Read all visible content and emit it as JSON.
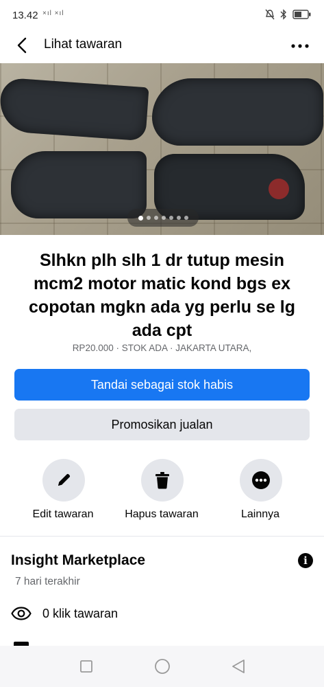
{
  "status_bar": {
    "time": "13.42",
    "signal_indicator": "×ıl ×ıl",
    "icons": [
      "mute-icon",
      "bluetooth-icon",
      "battery-icon"
    ]
  },
  "header": {
    "title": "Lihat tawaran",
    "back_icon": "chevron-left-icon",
    "more_icon": "more-horizontal-icon"
  },
  "photo": {
    "page_count": 7,
    "active_index": 0
  },
  "listing": {
    "title": "Slhkn plh slh 1 dr tutup mesin mcm2 motor matic kond bgs ex copotan mgkn ada yg perlu se lg ada cpt",
    "meta": "RP20.000 · STOK ADA · JAKARTA UTARA,"
  },
  "buttons": {
    "mark_sold": "Tandai sebagai stok habis",
    "promote": "Promosikan jualan"
  },
  "actions": [
    {
      "label": "Edit tawaran",
      "icon": "pencil-icon"
    },
    {
      "label": "Hapus tawaran",
      "icon": "trash-icon"
    },
    {
      "label": "Lainnya",
      "icon": "more-icon"
    }
  ],
  "insights": {
    "title": "Insight Marketplace",
    "subtitle": "7 hari terakhir",
    "stats": [
      {
        "label": "0 klik tawaran",
        "icon": "eye-icon"
      }
    ]
  },
  "colors": {
    "primary": "#1877f2",
    "secondary_bg": "#e4e6eb",
    "text": "#050505",
    "muted": "#65676b"
  }
}
